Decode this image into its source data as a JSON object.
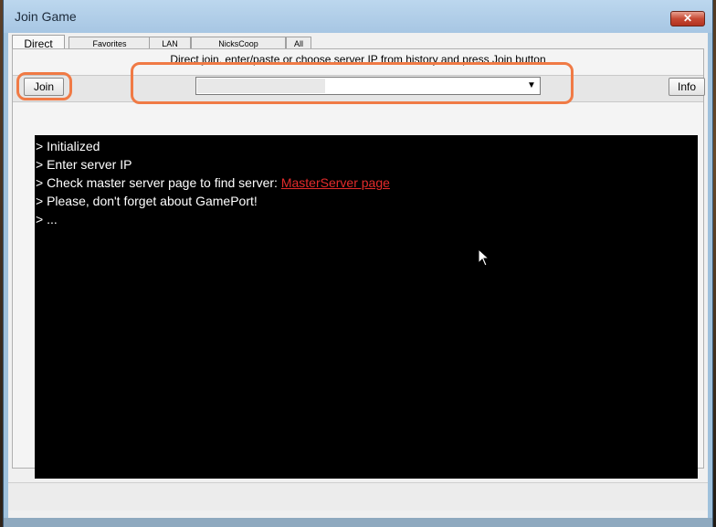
{
  "window": {
    "title": "Join Game",
    "close_label": "✕"
  },
  "tabs": [
    {
      "label": "Direct",
      "active": true
    },
    {
      "label": "Favorites",
      "active": false
    },
    {
      "label": "LAN",
      "active": false
    },
    {
      "label": "NicksCoop",
      "active": false
    },
    {
      "label": "All",
      "active": false
    }
  ],
  "direct": {
    "hint": "Direct join, enter/paste or choose server IP from history and press Join button",
    "join_label": "Join",
    "info_label": "Info",
    "server_combo": {
      "value": "",
      "placeholder": "",
      "arrow": "▼"
    }
  },
  "console": {
    "lines": [
      "> Initialized",
      "> Enter server IP",
      "> Check master server page to find server: ",
      "> Please, don't forget about GamePort!",
      "> ..."
    ],
    "link_text": "MasterServer page"
  },
  "colors": {
    "highlight": "#f07a45",
    "link": "#e32b2b"
  }
}
